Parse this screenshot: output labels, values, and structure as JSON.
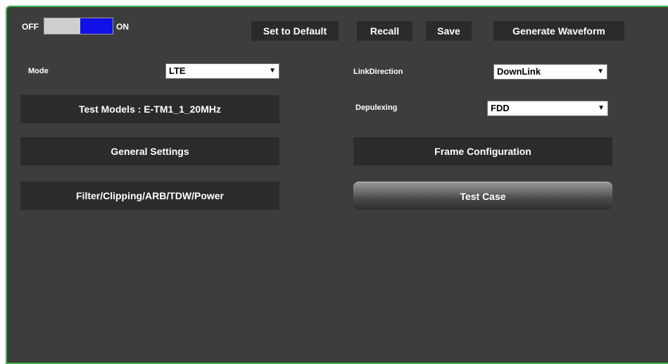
{
  "toggle": {
    "off_label": "OFF",
    "on_label": "ON",
    "state": "on"
  },
  "toolbar": {
    "set_default": "Set to Default",
    "recall": "Recall",
    "save": "Save",
    "generate": "Generate Waveform"
  },
  "fields": {
    "mode": {
      "label": "Mode",
      "value": "LTE"
    },
    "link_direction": {
      "label": "LinkDirection",
      "value": "DownLink"
    },
    "duplexing": {
      "label": "Depulexing",
      "value": "FDD"
    }
  },
  "buttons": {
    "test_models": "Test Models : E-TM1_1_20MHz",
    "general_settings": "General Settings",
    "frame_configuration": "Frame Configuration",
    "filter": "Filter/Clipping/ARB/TDW/Power",
    "test_case": "Test Case"
  },
  "colors": {
    "panel_bg": "#3d3d3d",
    "button_bg": "#2b2b2b",
    "border_accent": "#3fb34a",
    "toggle_on": "#1010e8"
  },
  "icons": {
    "dropdown_arrow": "caret-down-icon"
  }
}
